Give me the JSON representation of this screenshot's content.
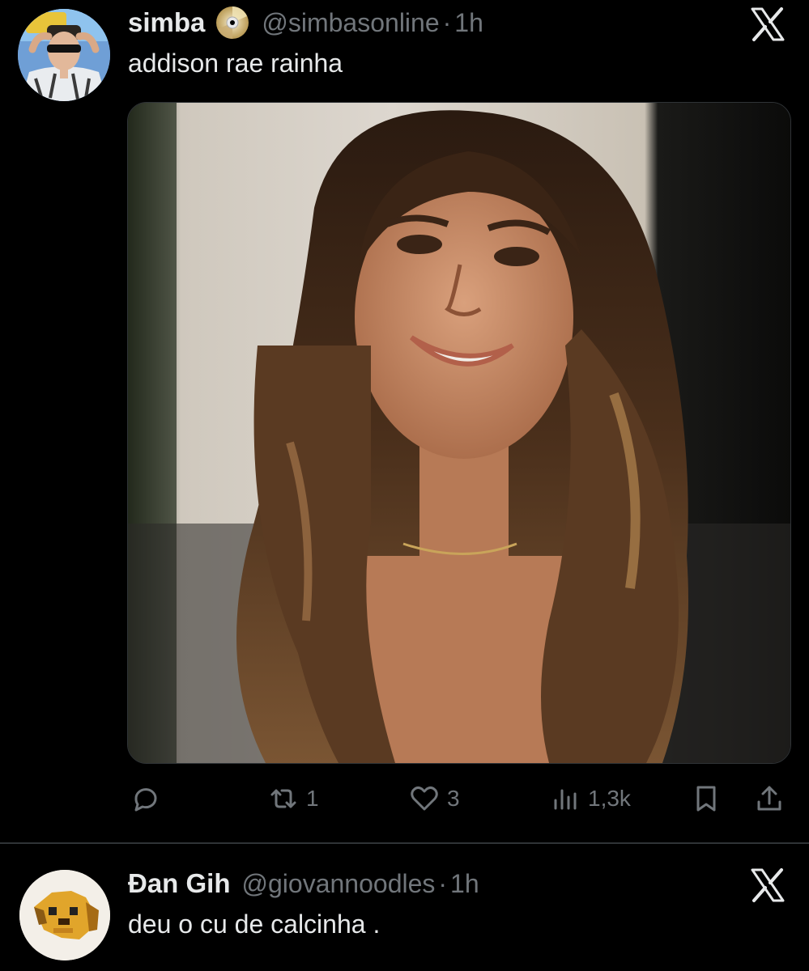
{
  "tweet": {
    "name": "simba",
    "handle": "@simbasonline",
    "separator": "·",
    "time": "1h",
    "text": "addison rae rainha",
    "badge_icon": "cd-disc-icon",
    "actions": {
      "reply_count": "",
      "retweet_count": "1",
      "like_count": "3",
      "views_count": "1,3k"
    }
  },
  "reply": {
    "name": "Đan Gih",
    "handle": "@giovannoodles",
    "separator": "·",
    "time": "1h",
    "text": "deu o cu de calcinha ."
  },
  "colors": {
    "background": "#000000",
    "text": "#e7e9ea",
    "secondary": "#71767b",
    "divider": "#2f3336"
  }
}
